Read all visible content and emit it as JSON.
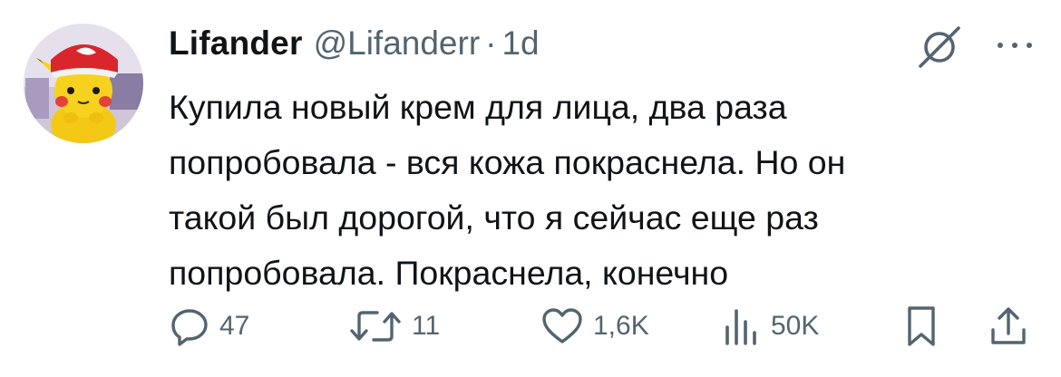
{
  "author": {
    "display_name": "Lifander",
    "handle": "@Lifanderr",
    "separator": "·",
    "time": "1d"
  },
  "tweet": {
    "lines": [
      "Купила новый крем для лица, два раза",
      "попробовала - вся кожа покраснела. Но он",
      "такой был дорогой, что я сейчас еще раз",
      "попробовала. Покраснела, конечно"
    ]
  },
  "actions": {
    "replies": "47",
    "reposts": "11",
    "likes": "1,6K",
    "views": "50K"
  },
  "icons": {
    "reply": "reply-icon",
    "repost": "repost-icon",
    "like": "heart-icon",
    "views": "views-chart-icon",
    "bookmark": "bookmark-icon",
    "share": "share-icon",
    "grok": "grok-icon",
    "more": "more-icon"
  },
  "colors": {
    "text": "#0f1419",
    "secondary": "#536471"
  }
}
